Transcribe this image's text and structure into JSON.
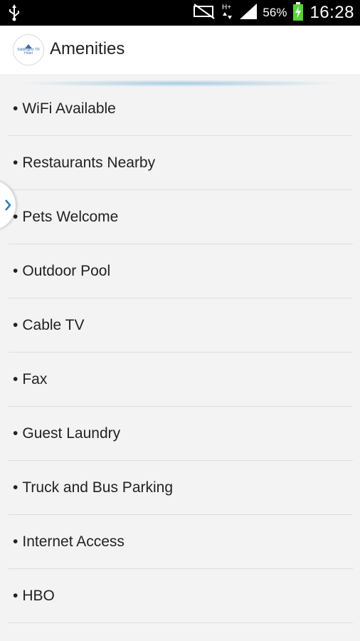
{
  "status_bar": {
    "battery_percent": "56%",
    "time": "16:28",
    "icons": [
      "usb-icon",
      "mute-icon",
      "data-h-plus-icon",
      "signal-icon",
      "battery-charging-icon"
    ]
  },
  "app_bar": {
    "logo_lines": [
      "Siddington TR",
      "Hotel"
    ],
    "title": "Amenities"
  },
  "amenities": [
    "WiFi Available",
    "Restaurants Nearby",
    "Pets Welcome",
    "Outdoor Pool",
    "Cable TV",
    "Fax",
    "Guest Laundry",
    "Truck and Bus Parking",
    "Internet Access",
    "HBO"
  ],
  "colors": {
    "accent": "#2f7fb3",
    "status_bar_bg": "#000000",
    "battery_charge": "#5bd13b"
  }
}
